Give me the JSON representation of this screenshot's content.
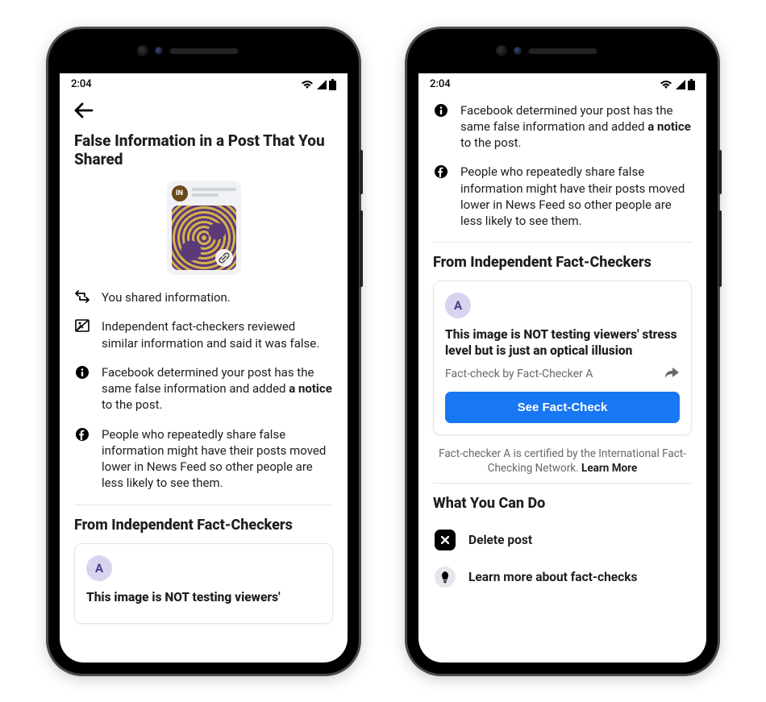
{
  "status": {
    "time": "2:04"
  },
  "phone1": {
    "title": "False Information in a Post That You Shared",
    "thumb_avatar": "IN",
    "rows": {
      "shared": "You shared information.",
      "reviewed": "Independent fact-checkers reviewed similar information and said it was false.",
      "determined_pre": "Facebook determined your post has the same false information and added ",
      "determined_bold": "a notice",
      "determined_post": " to the post.",
      "repeated": "People who repeatedly share false information might have their posts moved lower in News Feed so other people are less likely to see them."
    },
    "section_factcheckers": "From Independent Fact-Checkers",
    "fc_avatar": "A",
    "fc_title_partial": "This image is NOT testing viewers'"
  },
  "phone2": {
    "rows": {
      "determined_pre": "Facebook determined your post has the same false information and added ",
      "determined_bold": "a notice",
      "determined_post": " to the post.",
      "repeated": "People who repeatedly share false information might have their posts moved lower in News Feed so other people are less likely to see them."
    },
    "section_factcheckers": "From Independent Fact-Checkers",
    "fc_avatar": "A",
    "fc_title": "This image is NOT testing viewers' stress level but is just an optical illusion",
    "fc_meta": "Fact-check by Fact-Checker A",
    "fc_button": "See Fact-Check",
    "cert_note_pre": "Fact-checker A is certified by the International Fact-Checking Network. ",
    "cert_note_link": "Learn More",
    "section_actions": "What You Can Do",
    "action_delete": "Delete post",
    "action_learn": "Learn more about fact-checks"
  }
}
